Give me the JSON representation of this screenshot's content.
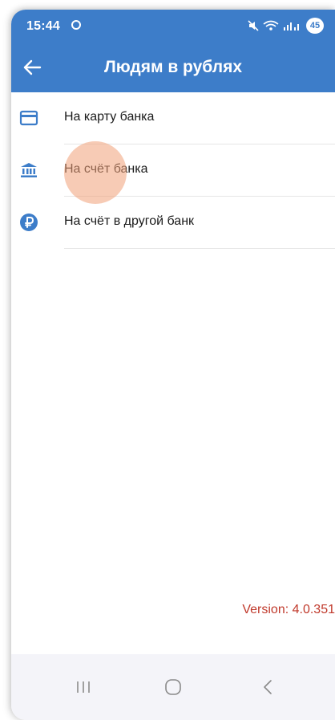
{
  "status_bar": {
    "time": "15:44",
    "battery": "45",
    "indicators": "mute-icon, wifi-icon, signal-icon"
  },
  "toolbar": {
    "back_icon": "arrow-left-icon",
    "title": "Людям в рублях"
  },
  "menu": {
    "items": [
      {
        "label": "На карту банка",
        "icon": "card-icon"
      },
      {
        "label": "На счёт банка",
        "icon": "bank-icon"
      },
      {
        "label": "На счёт в другой банк",
        "icon": "ruble-icon"
      }
    ]
  },
  "footer": {
    "version": "Version: 4.0.351"
  },
  "navbar": {
    "buttons": [
      "recent-apps-icon",
      "home-icon",
      "back-icon"
    ]
  },
  "colors": {
    "primary": "#3d7dc9",
    "version_text": "#c0392b",
    "touch_highlight": "#f0a078"
  }
}
